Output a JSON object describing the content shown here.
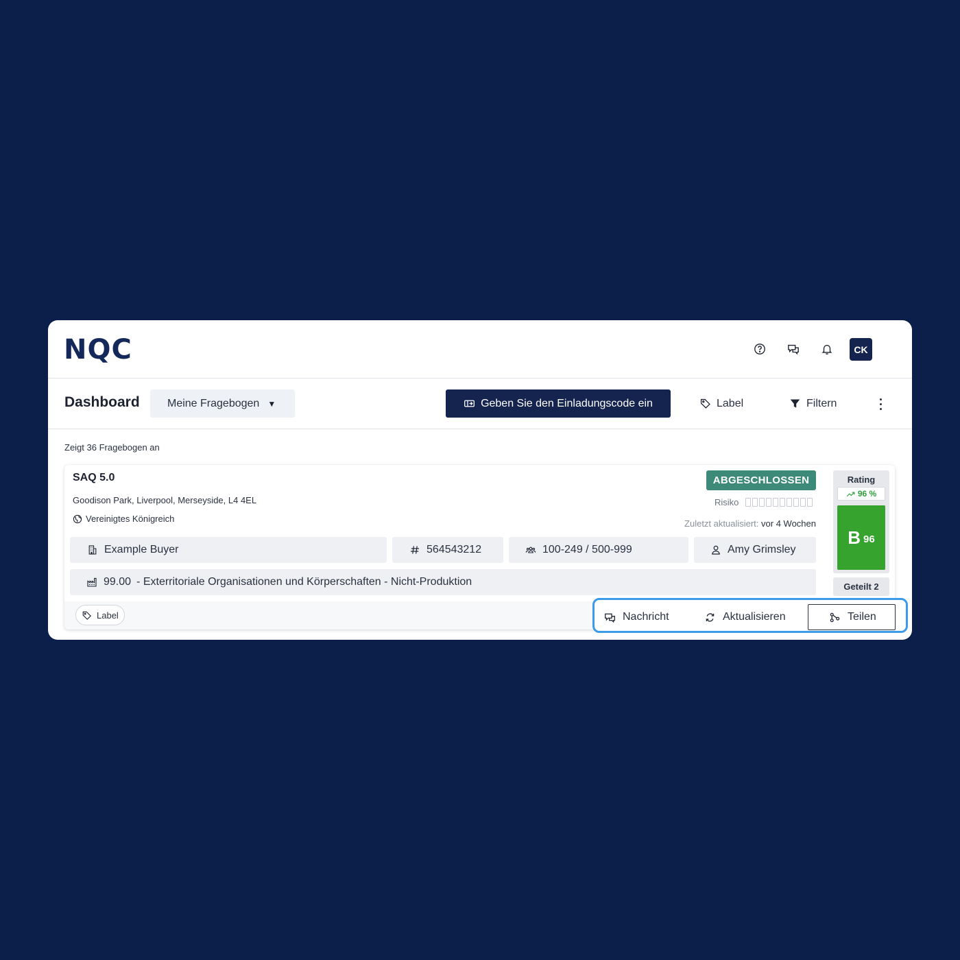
{
  "brand": {
    "logo_text": "NQC"
  },
  "header": {
    "avatar_initials": "CK"
  },
  "toolbar": {
    "title": "Dashboard",
    "dropdown_value": "Meine Fragebogen",
    "invite_button": "Geben Sie den Einladungscode ein",
    "label_button": "Label",
    "filter_button": "Filtern"
  },
  "list": {
    "count_text": "Zeigt 36 Fragebogen an"
  },
  "card": {
    "title": "SAQ 5.0",
    "address": "Goodison Park, Liverpool, Merseyside, L4 4EL",
    "country": "Vereinigtes Königreich",
    "status": "ABGESCHLOSSEN",
    "status_color": "#3d8a78",
    "risk_label": "Risiko",
    "risk_level": 0,
    "risk_max": 10,
    "updated_label": "Zuletzt aktualisiert:",
    "updated_value": "vor 4 Wochen",
    "buyer": "Example Buyer",
    "id_number": "564543212",
    "employees": "100-249 / 500-999",
    "contact": "Amy Grimsley",
    "industry_code": "99.00",
    "industry_name": "- Exterritoriale Organisationen und Körperschaften - Nicht-Produktion",
    "label_pill": "Label",
    "rating": {
      "title": "Rating",
      "trend": "96 %",
      "grade_letter": "B",
      "grade_score": "96",
      "grade_color": "#35a32e"
    },
    "shared": "Geteilt 2",
    "actions": {
      "message": "Nachricht",
      "refresh": "Aktualisieren",
      "share": "Teilen"
    },
    "highlight_color": "#3b9be8"
  }
}
